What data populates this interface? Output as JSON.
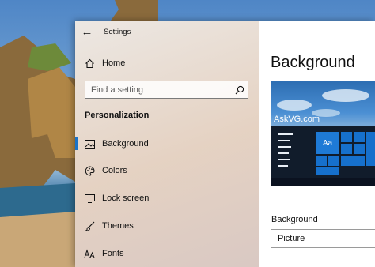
{
  "window": {
    "title": "Settings"
  },
  "nav": {
    "home_label": "Home",
    "search_placeholder": "Find a setting",
    "section_heading": "Personalization",
    "items": [
      {
        "label": "Background",
        "icon": "picture-icon",
        "selected": true
      },
      {
        "label": "Colors",
        "icon": "palette-icon",
        "selected": false
      },
      {
        "label": "Lock screen",
        "icon": "lock-screen-icon",
        "selected": false
      },
      {
        "label": "Themes",
        "icon": "brush-icon",
        "selected": false
      },
      {
        "label": "Fonts",
        "icon": "font-icon",
        "selected": false
      }
    ]
  },
  "content": {
    "page_title": "Background",
    "preview": {
      "watermark": "AskVG.com",
      "sample_text": "Aa"
    },
    "background_label": "Background",
    "background_value": "Picture"
  },
  "colors": {
    "accent": "#1a73c9",
    "tile": "#1670cc"
  }
}
